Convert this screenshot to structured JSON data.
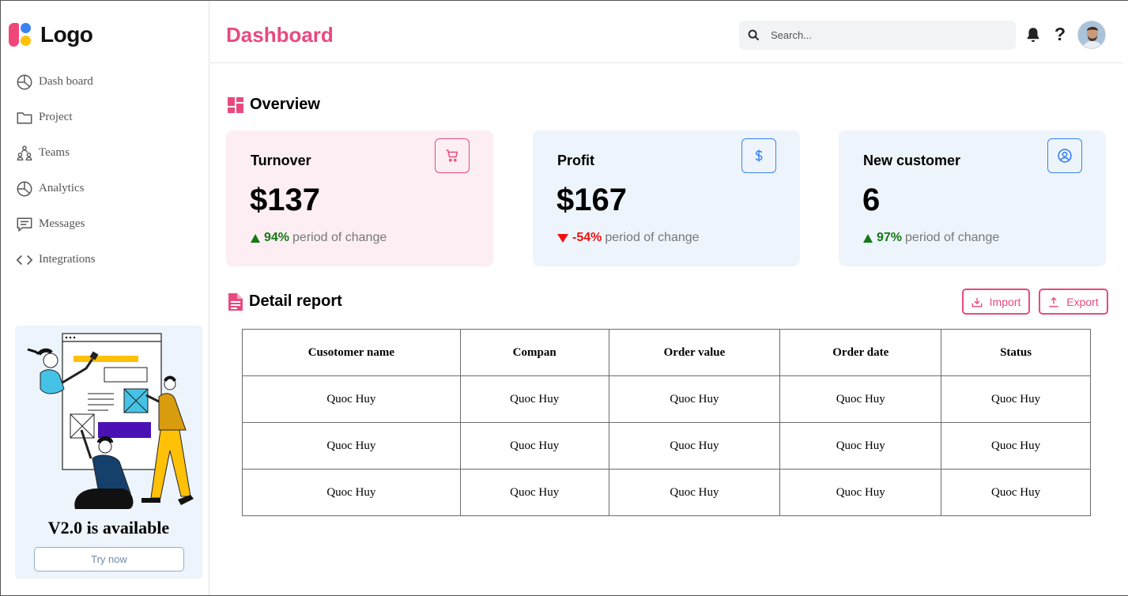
{
  "app": {
    "logo_text": "Logo",
    "page_title": "Dashboard",
    "search_placeholder": "Search...",
    "help_label": "?"
  },
  "sidebar": {
    "items": [
      {
        "label": "Dash board",
        "icon": "pie-chart-icon"
      },
      {
        "label": "Project",
        "icon": "folder-icon"
      },
      {
        "label": "Teams",
        "icon": "team-icon"
      },
      {
        "label": "Analytics",
        "icon": "pie-chart-icon"
      },
      {
        "label": "Messages",
        "icon": "message-icon"
      },
      {
        "label": "Integrations",
        "icon": "code-icon"
      }
    ],
    "promo": {
      "title": "V2.0 is available",
      "button": "Try now"
    }
  },
  "overview": {
    "title": "Overview",
    "cards": [
      {
        "label": "Turnover",
        "value": "$137",
        "change": "94%",
        "direction": "up",
        "suffix": "period of change",
        "icon": "cart-icon",
        "bg": "#fdeef3",
        "accent": "#e84a7f"
      },
      {
        "label": "Profit",
        "value": "$167",
        "change": "-54%",
        "direction": "down",
        "suffix": "period of change",
        "icon": "dollar-icon",
        "bg": "#eef4fc",
        "accent": "#3a83f1"
      },
      {
        "label": "New customer",
        "value": "6",
        "change": "97%",
        "direction": "up",
        "suffix": "period of change",
        "icon": "user-circle-icon",
        "bg": "#eef4fc",
        "accent": "#3a83f1"
      }
    ]
  },
  "report": {
    "title": "Detail report",
    "import_label": "Import",
    "export_label": "Export",
    "columns": [
      "Cusotomer name",
      "Compan",
      "Order value",
      "Order date",
      "Status"
    ],
    "rows": [
      [
        "Quoc Huy",
        "Quoc Huy",
        "Quoc Huy",
        "Quoc Huy",
        "Quoc Huy"
      ],
      [
        "Quoc Huy",
        "Quoc Huy",
        "Quoc Huy",
        "Quoc Huy",
        "Quoc Huy"
      ],
      [
        "Quoc Huy",
        "Quoc Huy",
        "Quoc Huy",
        "Quoc Huy",
        "Quoc Huy"
      ]
    ]
  },
  "colors": {
    "brand_pink": "#e84a7f",
    "brand_blue": "#3a83f1",
    "positive": "#137a13",
    "negative": "#ee1111"
  }
}
